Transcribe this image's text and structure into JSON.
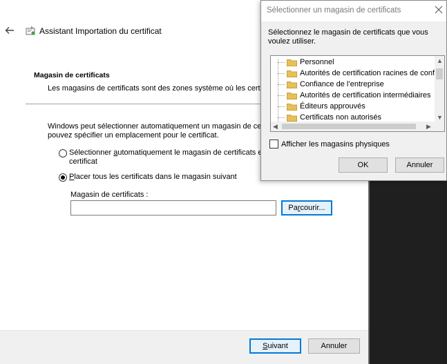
{
  "wizard": {
    "title": "Assistant Importation du certificat",
    "section_title": "Magasin de certificats",
    "section_desc": "Les magasins de certificats sont des zones système où les certifi",
    "paragraph": "Windows peut sélectionner automatiquement un magasin de certi pouvez spécifier un emplacement pour le certificat.",
    "radio_auto": {
      "label_pre": "Sélectionner ",
      "label_ul": "a",
      "label_post": "utomatiquement le magasin de certificats en",
      "label_line2": "certificat",
      "checked": false
    },
    "radio_manual": {
      "label_ul": "P",
      "label_post": "lacer tous les certificats dans le magasin suivant",
      "checked": true
    },
    "store_label": "Magasin de certificats :",
    "store_value": "",
    "browse": {
      "pre": "Pa",
      "ul": "r",
      "post": "courir..."
    },
    "next": {
      "ul": "S",
      "post": "uivant"
    },
    "cancel": "Annuler"
  },
  "dialog": {
    "title": "Sélectionner un magasin de certificats",
    "prompt": "Sélectionnez le magasin de certificats que vous voulez utiliser.",
    "stores": [
      "Personnel",
      "Autorités de certification racines de conf",
      "Confiance de l’entreprise",
      "Autorités de certification intermédiaires",
      "Éditeurs approuvés",
      "Certificats non autorisés"
    ],
    "show_physical": {
      "label": "Afficher les magasins physiques",
      "checked": false
    },
    "ok": "OK",
    "cancel": "Annuler"
  },
  "colors": {
    "accent": "#0078d7",
    "folder": "#e8c05a",
    "background_dark": "#1f1f1f",
    "dialog_title_text": "#7a7a7a"
  }
}
